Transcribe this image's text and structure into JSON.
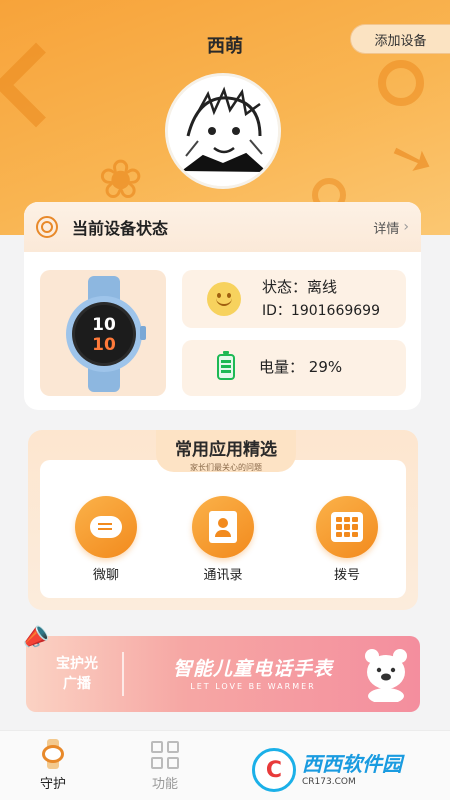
{
  "header": {
    "username": "西萌",
    "add_device_label": "添加设备",
    "avatar_icon": "user-avatar-icon"
  },
  "device_status": {
    "title": "当前设备状态",
    "detail_label": "详情",
    "status_line": "状态：离线",
    "id_line": "ID：1901669699",
    "battery_label": "电量：",
    "battery_value": "29%",
    "watch_face_text": "10 10"
  },
  "apps": {
    "title": "常用应用精选",
    "subtitle": "家长们最关心的问题",
    "items": [
      {
        "label": "微聊",
        "icon": "chat-icon"
      },
      {
        "label": "通讯录",
        "icon": "contacts-icon"
      },
      {
        "label": "拨号",
        "icon": "dial-icon"
      }
    ]
  },
  "banner": {
    "left_text_line1": "宝护光",
    "left_text_line2": "广播",
    "main_text": "智能儿童电话手表",
    "sub_text": "LET LOVE BE WARMER"
  },
  "tabbar": {
    "items": [
      {
        "label": "守护",
        "icon": "watch-icon",
        "active": true
      },
      {
        "label": "功能",
        "icon": "grid-icon",
        "active": false
      }
    ]
  },
  "watermark": {
    "logo_text": "C",
    "brand": "西西软件园",
    "domain": "CR173.COM"
  },
  "colors": {
    "accent": "#f28a1d",
    "hero": "#f9b552",
    "banner": "#f48e9e"
  }
}
